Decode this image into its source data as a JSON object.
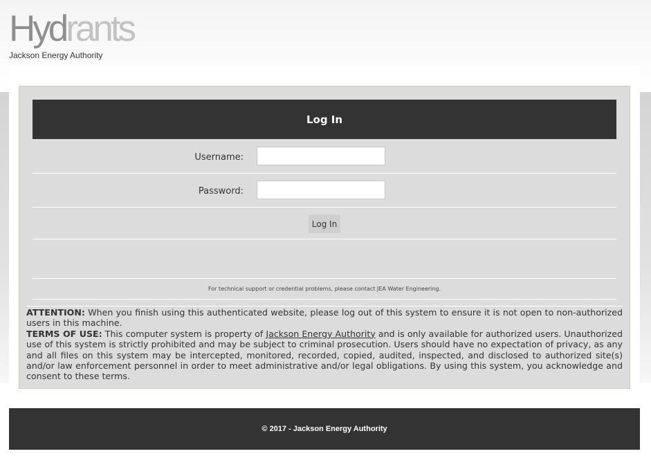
{
  "header": {
    "logo_part1": "Hyd",
    "logo_part2": "rants",
    "organization": "Jackson Energy Authority"
  },
  "login": {
    "title": "Log In",
    "username_label": "Username:",
    "username_value": "",
    "password_label": "Password:",
    "password_value": "",
    "submit_label": "Log In",
    "support_text": "For technical support or credential problems, please contact JEA Water Engineering."
  },
  "notice": {
    "attention_label": "ATTENTION:",
    "attention_text": " When you finish using this authenticated website, please log out of this system to ensure it is not open to non-authorized users in this machine.",
    "terms_label": "TERMS OF USE:",
    "terms_text_before": " This computer system is property of ",
    "terms_link": "Jackson Energy Authority",
    "terms_text_after": " and is only available for authorized users. Unauthorized use of this system is strictly prohibited and may be subject to criminal prosecution. Users should have no expectation of privacy, as any and all files on this system may be intercepted, monitored, recorded, copied, audited, inspected, and disclosed to authorized site(s) and/or law enforcement personnel in order to meet administrative and/or legal obligations. By using this system, you acknowledge and consent to these terms."
  },
  "footer": {
    "copyright": "© 2017 - Jackson Energy Authority"
  }
}
